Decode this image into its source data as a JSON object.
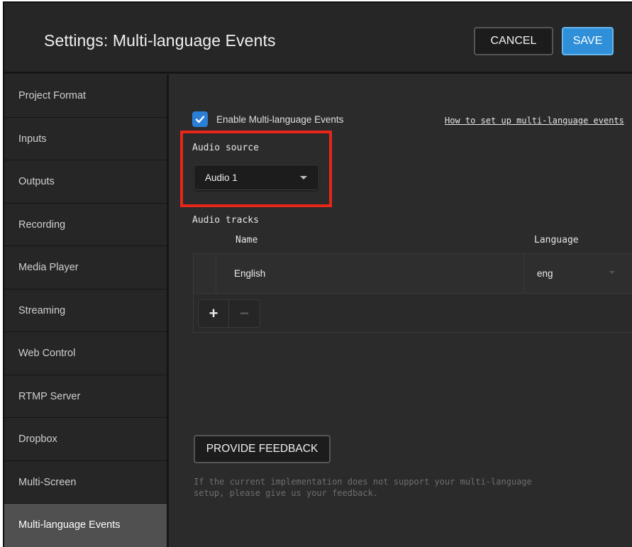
{
  "header": {
    "title": "Settings: Multi-language Events",
    "cancel_label": "CANCEL",
    "save_label": "SAVE"
  },
  "sidebar": {
    "items": [
      {
        "label": "Project Format"
      },
      {
        "label": "Inputs"
      },
      {
        "label": "Outputs"
      },
      {
        "label": "Recording"
      },
      {
        "label": "Media Player"
      },
      {
        "label": "Streaming"
      },
      {
        "label": "Web Control"
      },
      {
        "label": "RTMP Server"
      },
      {
        "label": "Dropbox"
      },
      {
        "label": "Multi-Screen"
      },
      {
        "label": "Multi-language Events",
        "active": true
      }
    ]
  },
  "main": {
    "enable_checkbox": {
      "label": "Enable Multi-language Events",
      "checked": true
    },
    "help_link": "How to set up multi-language events",
    "audio_source": {
      "label": "Audio source",
      "value": "Audio 1"
    },
    "audio_tracks": {
      "label": "Audio tracks",
      "columns": [
        "Name",
        "Language"
      ],
      "rows": [
        {
          "name": "English",
          "language": "eng"
        }
      ],
      "add_label": "+",
      "remove_label": "−"
    },
    "feedback_button": "PROVIDE FEEDBACK",
    "feedback_note": "If the current implementation does not support your multi-language setup, please give us your feedback."
  },
  "colors": {
    "accent": "#2f8fd8",
    "highlight_box": "#e8261a",
    "background": "#2b2b2b",
    "sidebar_active": "#505050"
  }
}
